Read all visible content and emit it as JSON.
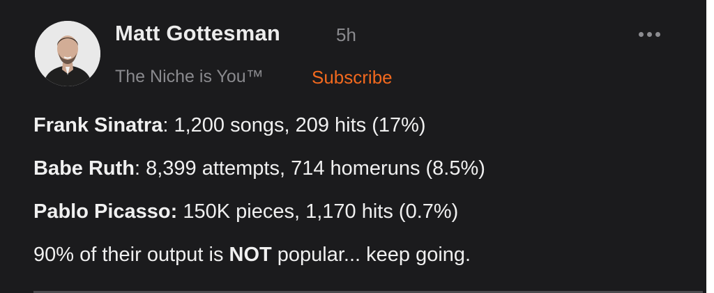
{
  "post": {
    "author": "Matt Gottesman",
    "time_ago": "5h",
    "publication": "The Niche is You™",
    "subscribe_label": "Subscribe",
    "more_icon": "more-horizontal-icon",
    "lines": [
      {
        "bold": "Frank Sinatra",
        "rest": ": 1,200 songs, 209 hits (17%)"
      },
      {
        "bold": "Babe Ruth",
        "rest": ": 8,399 attempts, 714 homeruns (8.5%)"
      },
      {
        "bold": "Pablo Picasso:",
        "rest": " 150K pieces, 1,170 hits (0.7%)"
      }
    ],
    "closing": {
      "before": "90% of their output is ",
      "bold": "NOT",
      "after": " popular... keep going."
    }
  },
  "colors": {
    "background": "#1b1b1d",
    "text": "#f0f0f0",
    "muted": "#8a8a8e",
    "accent": "#f2691e"
  }
}
